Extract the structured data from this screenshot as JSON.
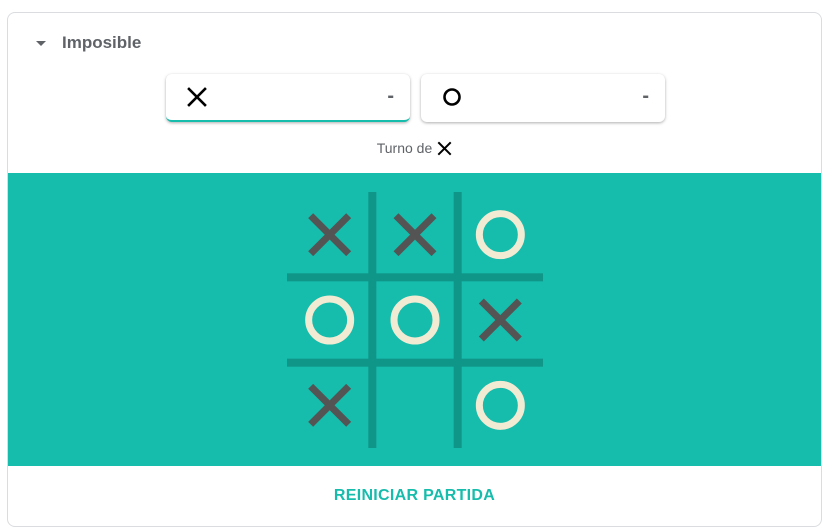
{
  "difficulty": {
    "label": "Imposible"
  },
  "players": [
    {
      "mark": "X",
      "score": "-",
      "active": true
    },
    {
      "mark": "O",
      "score": "-",
      "active": false
    }
  ],
  "turn": {
    "label": "Turno de",
    "mark": "X"
  },
  "board": {
    "cells": [
      "X",
      "X",
      "O",
      "O",
      "O",
      "X",
      "X",
      "",
      "O"
    ]
  },
  "colors": {
    "accent": "#16bcac",
    "grid_line": "#0f9688",
    "x_mark": "#545454",
    "o_mark": "#f2ebd3"
  },
  "footer": {
    "reset_label": "REINICIAR PARTIDA"
  }
}
